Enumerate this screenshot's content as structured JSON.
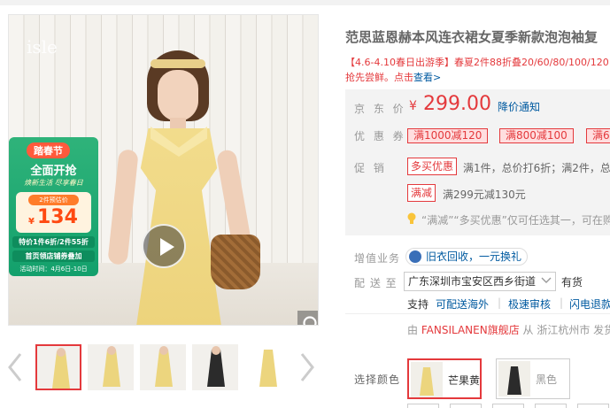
{
  "gallery": {
    "brand_watermark": "isle",
    "promo": {
      "title": "踏春节",
      "subtitle": "全面开抢",
      "tagline": "焕新生活 尽享春日",
      "price_label": "2件预估价",
      "price_yen": "¥",
      "price": "134",
      "line1": "特价1件6折/2件55折",
      "line2": "首页领店铺券叠加",
      "date": "活动时间：4月6日-10日"
    },
    "thumbnails": [
      {
        "label": "thumb-1",
        "active": true,
        "color": "#ecd57e"
      },
      {
        "label": "thumb-2",
        "active": false,
        "color": "#ecd57e"
      },
      {
        "label": "thumb-3",
        "active": false,
        "color": "#ecd57e"
      },
      {
        "label": "thumb-4",
        "active": false,
        "color": "#2b2b2b"
      },
      {
        "label": "thumb-5",
        "active": false,
        "color": "#ecd57e"
      }
    ]
  },
  "product": {
    "title": "范思蓝恩赫本风连衣裙女夏季新款泡泡袖复",
    "promo_line1": "【4.6-4.10春日出游季】春夏2件88折叠20/60/80/100/120",
    "promo_line2_text": "抢先尝鲜。点击",
    "promo_line2_link": "查看>",
    "price_label": "京 东 价",
    "price_yen": "¥",
    "price": "299.00",
    "price_notify": "降价通知",
    "coupon_label": "优 惠 券",
    "coupons": [
      "满1000减120",
      "满800减100",
      "满6"
    ],
    "promotion_label": "促    销",
    "promo_tag1": "多买优惠",
    "promo_desc1": "满1件，总价打6折；满2件，总",
    "promo_tag2": "满减",
    "promo_desc2": "满299元减130元",
    "tip": "“满减”“多买优惠”仅可任选其一，可在购",
    "value_added_label": "增值业务",
    "recycle": "旧衣回收，一元换礼",
    "ship_to_label": "配 送 至",
    "address": "广东深圳市宝安区西乡街道",
    "stock": "有货",
    "support_label": "支持",
    "services": [
      "可配送海外",
      "极速审核",
      "闪电退款"
    ],
    "shop_prefix": "由",
    "shop_name": "FANSILANEN旗舰店",
    "shop_suffix": "从 浙江杭州市 发货",
    "color_label": "选择颜色",
    "colors": [
      {
        "name": "芒果黄",
        "swatch": "#ecd57e",
        "selected": true
      },
      {
        "name": "黑色",
        "swatch": "#2b2b2b",
        "selected": false
      }
    ],
    "accent": "#e4393c",
    "link_color": "#005aa0"
  }
}
